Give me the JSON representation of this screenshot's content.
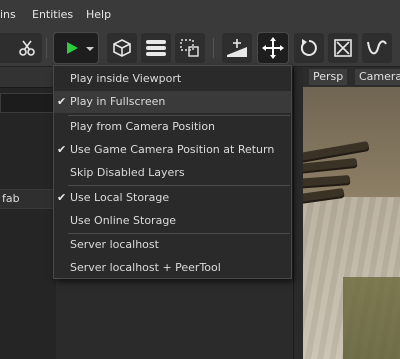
{
  "menubar": {
    "items": [
      "ins",
      "Entities",
      "Help"
    ]
  },
  "toolbar": {
    "buttons": [
      "crop-icon",
      "cut-icon",
      "play-icon",
      "dropdown-arrow-icon",
      "cube-icon",
      "layers-icon",
      "select-region-icon",
      "snap-to-ground-icon",
      "move-icon",
      "rotate-icon",
      "scale-icon",
      "curve-icon"
    ]
  },
  "left_panel": {
    "row_label": "fab"
  },
  "view_tabs": [
    "Persp",
    "Camera"
  ],
  "play_menu": {
    "items": [
      {
        "label": "Play inside Viewport",
        "checked": false
      },
      {
        "label": "Play in Fullscreen",
        "checked": true,
        "highlighted": true
      },
      {
        "label": "Play from Camera Position",
        "checked": false
      },
      {
        "label": "Use Game Camera Position at Return",
        "checked": true
      },
      {
        "label": "Skip Disabled Layers",
        "checked": false
      },
      {
        "label": "Use Local Storage",
        "checked": true
      },
      {
        "label": "Use Online Storage",
        "checked": false
      },
      {
        "label": "Server localhost",
        "checked": false
      },
      {
        "label": "Server localhost + PeerTool",
        "checked": false
      }
    ],
    "check_glyph": "✔"
  },
  "colors": {
    "play_green": "#2ecc40",
    "menu_bg": "#2a2a2a",
    "highlight": "#3a3a3a"
  }
}
